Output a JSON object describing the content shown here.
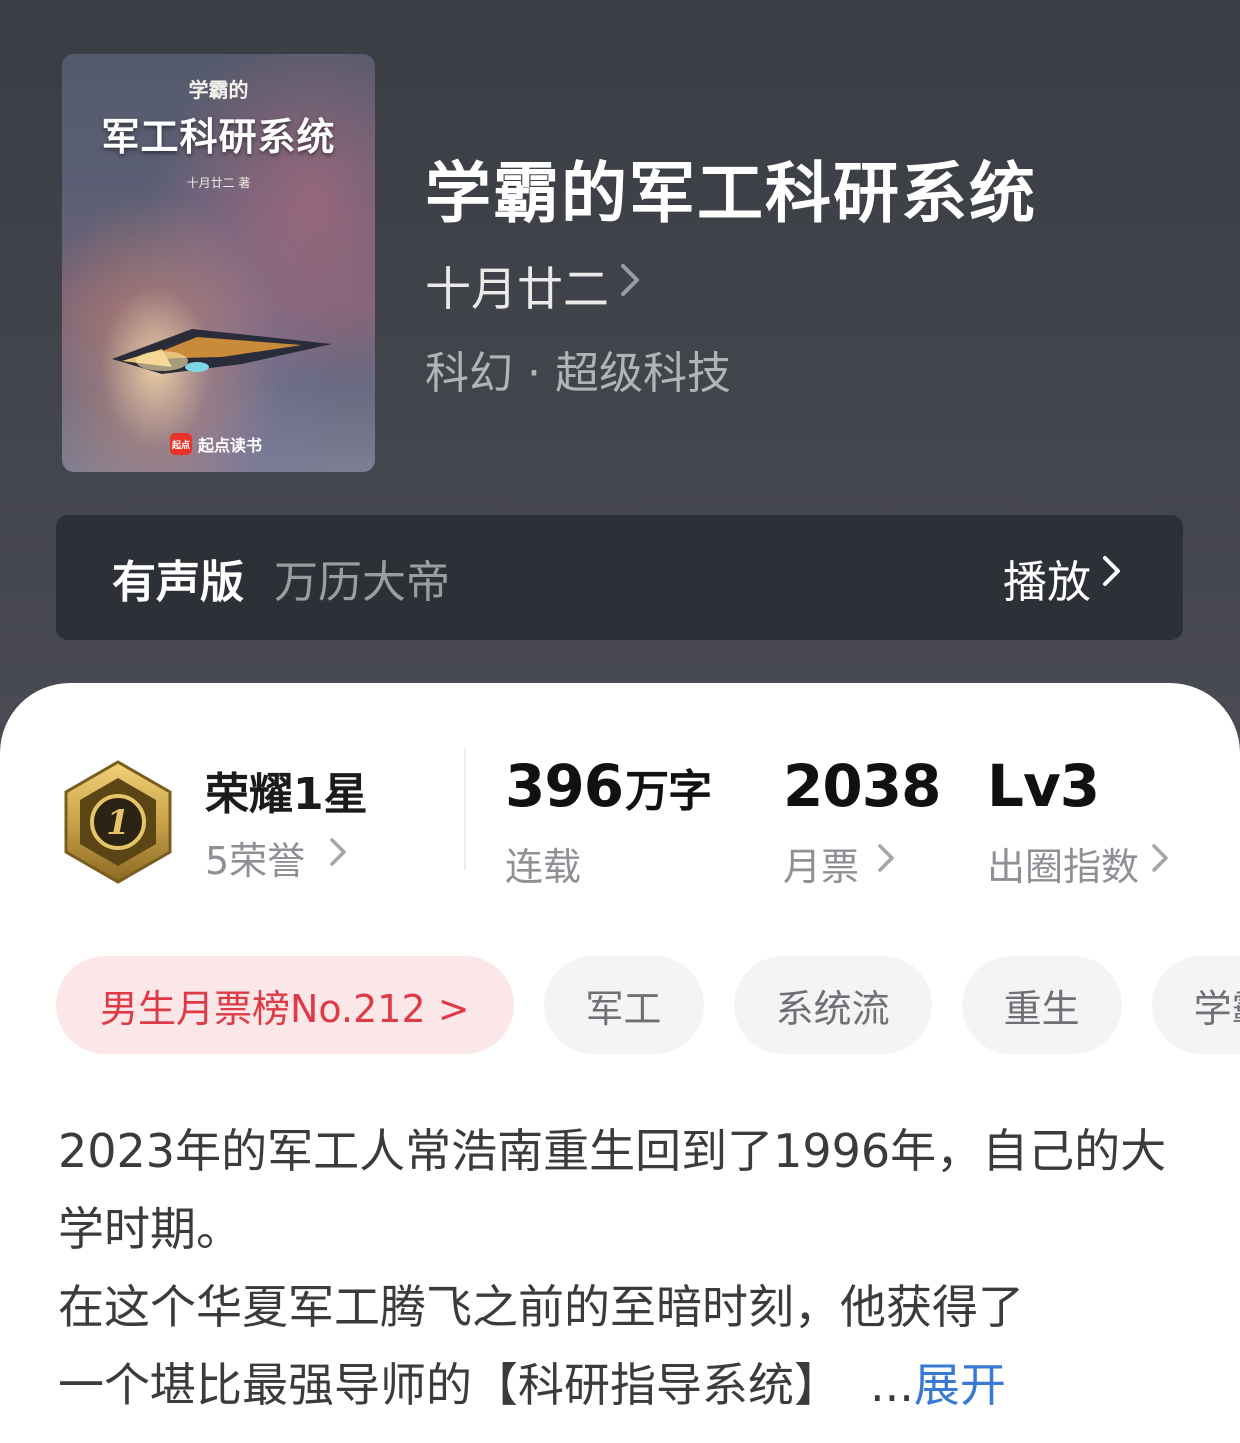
{
  "book": {
    "title": "学霸的军工科研系统",
    "author": "十月廿二",
    "genre": "科幻 · 超级科技"
  },
  "cover": {
    "subtitle": "学霸的",
    "title": "军工科研系统",
    "author_line": "十月廿二 著",
    "brand_mark": "起点",
    "brand": "起点读书"
  },
  "audio": {
    "label": "有声版",
    "narrator": "万历大帝",
    "play_label": "播放"
  },
  "honor": {
    "badge_number": "1",
    "title": "荣耀1星",
    "subtitle": "5荣誉"
  },
  "stats": [
    {
      "value": "396",
      "unit": "万字",
      "label": "连载"
    },
    {
      "value": "2038",
      "unit": "",
      "label": "月票"
    },
    {
      "value": "Lv3",
      "unit": "",
      "label": "出圈指数"
    }
  ],
  "tags": [
    {
      "label": "男生月票榜No.212 >"
    },
    {
      "label": "军工"
    },
    {
      "label": "系统流"
    },
    {
      "label": "重生"
    },
    {
      "label": "学霸"
    }
  ],
  "description": {
    "line1": "2023年的军工人常浩南重生回到了1996年，自己的大学时期。",
    "line2": "在这个华夏军工腾飞之前的至暗时刻，他获得了",
    "line3": "一个堪比最强导师的【科研指导系统】",
    "ellipsis": "...",
    "expand_label": "展开"
  },
  "colors": {
    "header_bg": "#3f4149",
    "audio_bar_bg": "#2e3037",
    "rank_tag_bg": "#fce7e8",
    "rank_tag_text": "#de3b47",
    "expand_link": "#3979d6",
    "badge_gold": "#c9a24a"
  },
  "icons": {
    "chevron": "chevron-right-icon",
    "badge": "honor-badge-icon"
  }
}
